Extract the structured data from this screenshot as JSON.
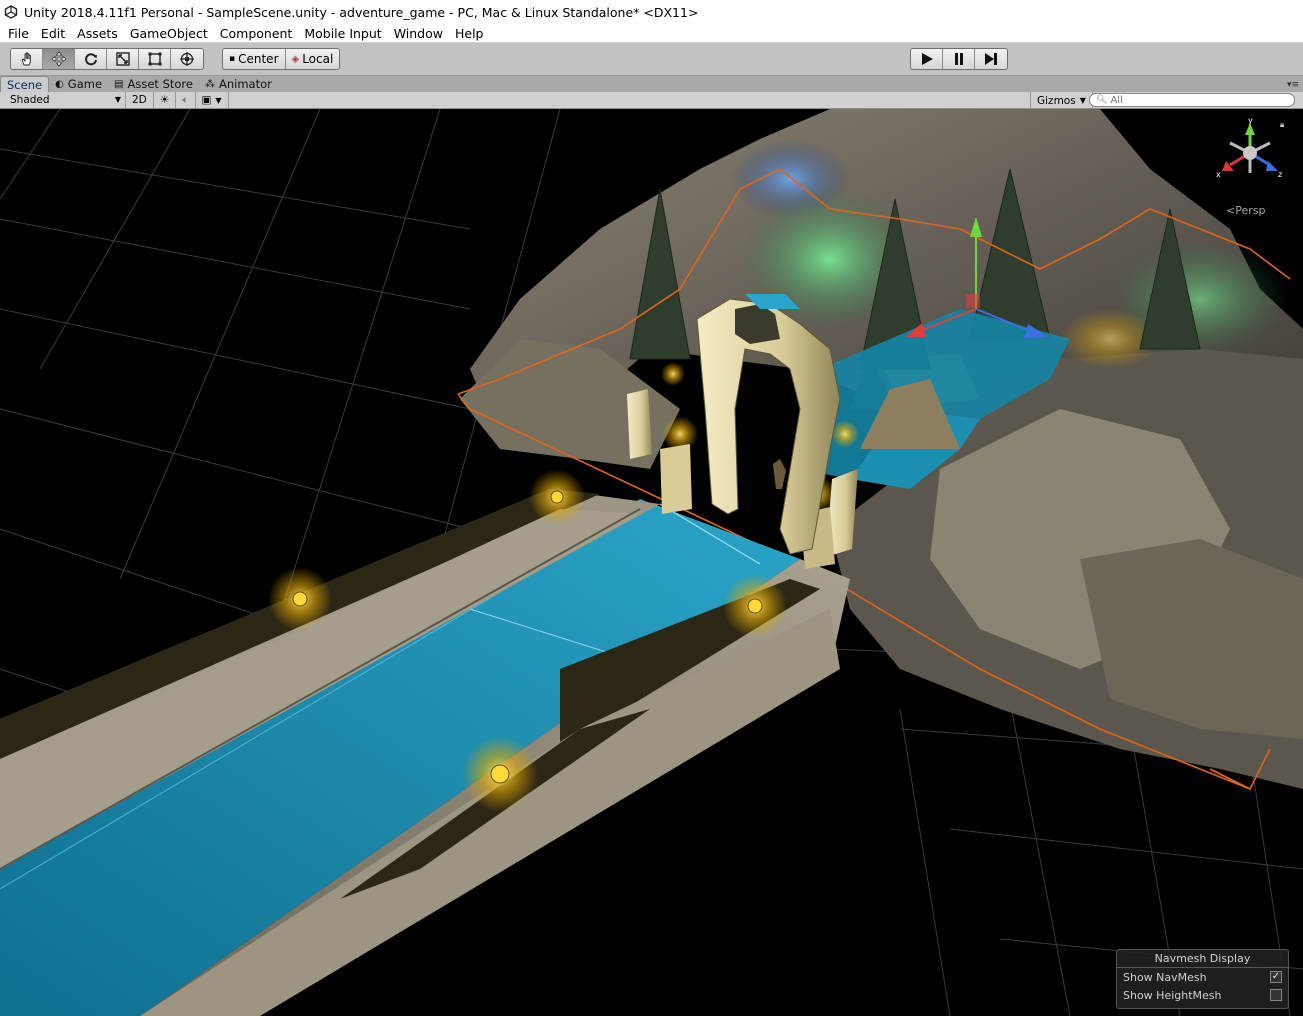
{
  "window": {
    "title": "Unity 2018.4.11f1 Personal - SampleScene.unity - adventure_game - PC, Mac & Linux Standalone* <DX11>"
  },
  "menu": [
    "File",
    "Edit",
    "Assets",
    "GameObject",
    "Component",
    "Mobile Input",
    "Window",
    "Help"
  ],
  "toolbar": {
    "tools": [
      "hand-icon",
      "move-icon",
      "rotate-icon",
      "scale-icon",
      "rect-icon",
      "transform-icon"
    ],
    "active_tool": "move-icon",
    "pivot": "Center",
    "space": "Local"
  },
  "tabs": [
    {
      "label": "Scene",
      "icon": "scene-icon",
      "active": true
    },
    {
      "label": "Game",
      "icon": "game-icon",
      "active": false
    },
    {
      "label": "Asset Store",
      "icon": "store-icon",
      "active": false
    },
    {
      "label": "Animator",
      "icon": "animator-icon",
      "active": false
    }
  ],
  "scene_toolbar": {
    "shading": "Shaded",
    "mode_2d": "2D",
    "gizmos": "Gizmos",
    "search_placeholder": "All"
  },
  "viewport": {
    "projection": "Persp",
    "axis_labels": {
      "x": "x",
      "y": "y",
      "z": "z"
    }
  },
  "navmesh_display": {
    "title": "Navmesh Display",
    "show_navmesh_label": "Show NavMesh",
    "show_navmesh": true,
    "show_heightmesh_label": "Show HeightMesh",
    "show_heightmesh": false
  },
  "colors": {
    "navmesh": "#1a8fb0",
    "boundary": "#e0641e",
    "stone": "#a59e8c",
    "lamp": "#ffd83a"
  }
}
